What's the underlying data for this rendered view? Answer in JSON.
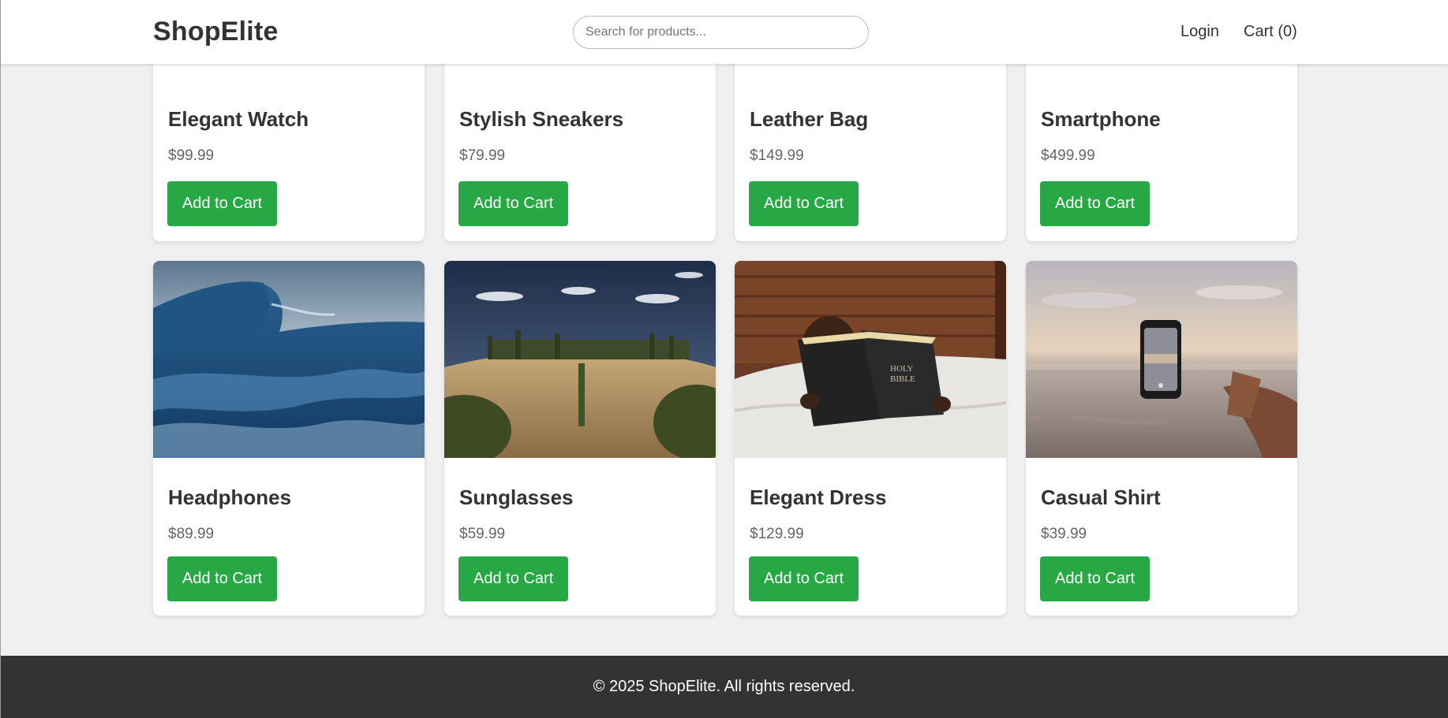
{
  "header": {
    "logo": "ShopElite",
    "search_placeholder": "Search for products...",
    "login_label": "Login",
    "cart_label": "Cart (0)"
  },
  "products": [
    {
      "name": "Elegant Watch",
      "price": "$99.99",
      "button": "Add to Cart",
      "image": "watch-photo"
    },
    {
      "name": "Stylish Sneakers",
      "price": "$79.99",
      "button": "Add to Cart",
      "image": "sneakers-photo"
    },
    {
      "name": "Leather Bag",
      "price": "$149.99",
      "button": "Add to Cart",
      "image": "bag-photo"
    },
    {
      "name": "Smartphone",
      "price": "$499.99",
      "button": "Add to Cart",
      "image": "smartphone-photo"
    },
    {
      "name": "Headphones",
      "price": "$89.99",
      "button": "Add to Cart",
      "image": "ocean-wave-photo"
    },
    {
      "name": "Sunglasses",
      "price": "$59.99",
      "button": "Add to Cart",
      "image": "tuscany-hill-photo"
    },
    {
      "name": "Elegant Dress",
      "price": "$129.99",
      "button": "Add to Cart",
      "image": "child-reading-bible-photo"
    },
    {
      "name": "Casual Shirt",
      "price": "$39.99",
      "button": "Add to Cart",
      "image": "phone-sunset-beach-photo"
    }
  ],
  "footer": {
    "copyright": "© 2025 ShopElite. All rights reserved."
  },
  "colors": {
    "accent_button": "#28a745",
    "page_background": "#f0f0f0",
    "footer_background": "#333333"
  }
}
